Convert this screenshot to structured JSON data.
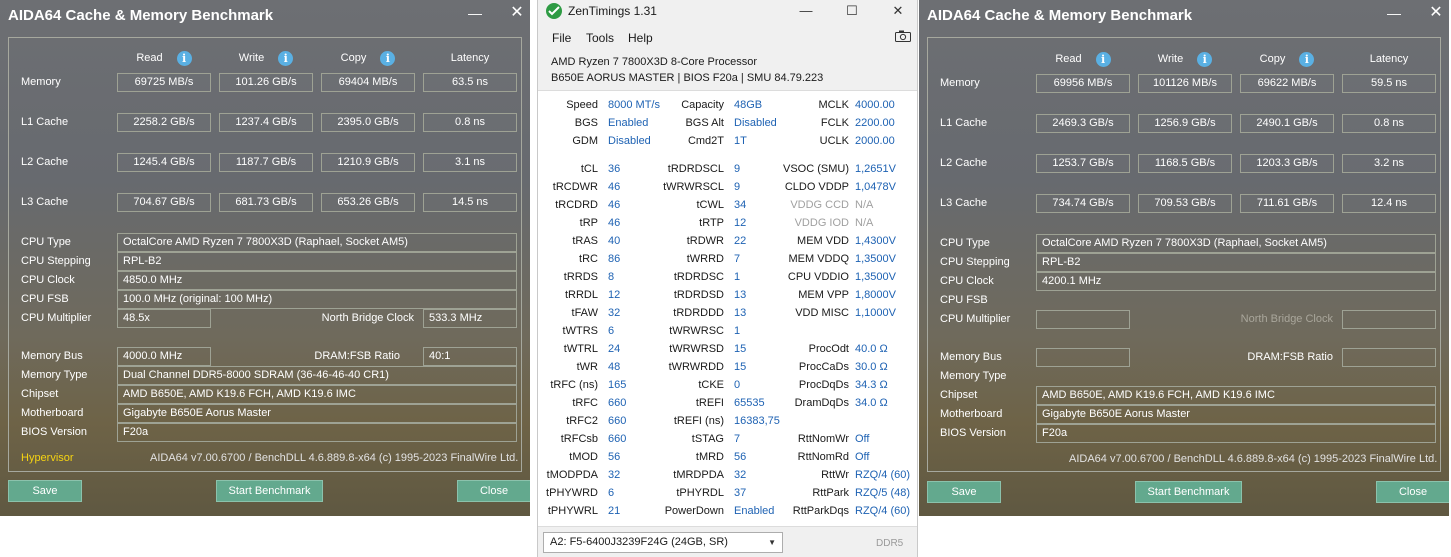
{
  "left": {
    "title": "AIDA64 Cache & Memory Benchmark",
    "min_glyph": "—",
    "close_glyph": "✕",
    "headers": [
      "Read",
      "Write",
      "Copy",
      "Latency"
    ],
    "rows": [
      {
        "label": "Memory",
        "read": "69725 MB/s",
        "write": "101.26 GB/s",
        "copy": "69404 MB/s",
        "latency": "63.5 ns"
      },
      {
        "label": "L1 Cache",
        "read": "2258.2 GB/s",
        "write": "1237.4 GB/s",
        "copy": "2395.0 GB/s",
        "latency": "0.8 ns"
      },
      {
        "label": "L2 Cache",
        "read": "1245.4 GB/s",
        "write": "1187.7 GB/s",
        "copy": "1210.9 GB/s",
        "latency": "3.1 ns"
      },
      {
        "label": "L3 Cache",
        "read": "704.67 GB/s",
        "write": "681.73 GB/s",
        "copy": "653.26 GB/s",
        "latency": "14.5 ns"
      }
    ],
    "cpu_type_label": "CPU Type",
    "cpu_type": "OctalCore AMD Ryzen 7 7800X3D  (Raphael, Socket AM5)",
    "cpu_stepping_label": "CPU Stepping",
    "cpu_stepping": "RPL-B2",
    "cpu_clock_label": "CPU Clock",
    "cpu_clock": "4850.0 MHz",
    "cpu_fsb_label": "CPU FSB",
    "cpu_fsb": "100.0 MHz  (original: 100 MHz)",
    "cpu_mult_label": "CPU Multiplier",
    "cpu_mult": "48.5x",
    "nb_clock_label": "North Bridge Clock",
    "nb_clock": "533.3 MHz",
    "mem_bus_label": "Memory Bus",
    "mem_bus": "4000.0 MHz",
    "dram_ratio_label": "DRAM:FSB Ratio",
    "dram_ratio": "40:1",
    "mem_type_label": "Memory Type",
    "mem_type": "Dual Channel DDR5-8000 SDRAM  (36-46-46-40 CR1)",
    "chipset_label": "Chipset",
    "chipset": "AMD B650E, AMD K19.6 FCH, AMD K19.6 IMC",
    "mobo_label": "Motherboard",
    "mobo": "Gigabyte B650E Aorus Master",
    "bios_label": "BIOS Version",
    "bios": "F20a",
    "hypervisor": "Hypervisor",
    "footer": "AIDA64 v7.00.6700 / BenchDLL 4.6.889.8-x64  (c) 1995-2023 FinalWire Ltd.",
    "save": "Save",
    "start": "Start Benchmark",
    "close": "Close"
  },
  "right": {
    "title": "AIDA64 Cache & Memory Benchmark",
    "min_glyph": "—",
    "close_glyph": "✕",
    "headers": [
      "Read",
      "Write",
      "Copy",
      "Latency"
    ],
    "rows": [
      {
        "label": "Memory",
        "read": "69956 MB/s",
        "write": "101126 MB/s",
        "copy": "69622 MB/s",
        "latency": "59.5 ns"
      },
      {
        "label": "L1 Cache",
        "read": "2469.3 GB/s",
        "write": "1256.9 GB/s",
        "copy": "2490.1 GB/s",
        "latency": "0.8 ns"
      },
      {
        "label": "L2 Cache",
        "read": "1253.7 GB/s",
        "write": "1168.5 GB/s",
        "copy": "1203.3 GB/s",
        "latency": "3.2 ns"
      },
      {
        "label": "L3 Cache",
        "read": "734.74 GB/s",
        "write": "709.53 GB/s",
        "copy": "711.61 GB/s",
        "latency": "12.4 ns"
      }
    ],
    "cpu_type_label": "CPU Type",
    "cpu_type": "OctalCore AMD Ryzen 7 7800X3D  (Raphael, Socket AM5)",
    "cpu_stepping_label": "CPU Stepping",
    "cpu_stepping": "RPL-B2",
    "cpu_clock_label": "CPU Clock",
    "cpu_clock": "4200.1 MHz",
    "cpu_fsb_label": "CPU FSB",
    "cpu_fsb": "",
    "cpu_mult_label": "CPU Multiplier",
    "cpu_mult": "",
    "nb_clock_label": "North Bridge Clock",
    "nb_clock": "",
    "mem_bus_label": "Memory Bus",
    "mem_bus": "",
    "dram_ratio_label": "DRAM:FSB Ratio",
    "dram_ratio": "",
    "mem_type_label": "Memory Type",
    "mem_type": "",
    "chipset_label": "Chipset",
    "chipset": "AMD B650E, AMD K19.6 FCH, AMD K19.6 IMC",
    "mobo_label": "Motherboard",
    "mobo": "Gigabyte B650E Aorus Master",
    "bios_label": "BIOS Version",
    "bios": "F20a",
    "hypervisor": "",
    "footer": "AIDA64 v7.00.6700 / BenchDLL 4.6.889.8-x64  (c) 1995-2023 FinalWire Ltd.",
    "save": "Save",
    "start": "Start Benchmark",
    "close": "Close"
  },
  "zen": {
    "title": "ZenTimings 1.31",
    "ctl_min": "—",
    "ctl_max": "☐",
    "ctl_close": "✕",
    "menu": [
      "File",
      "Tools",
      "Help"
    ],
    "cpu": "AMD Ryzen 7 7800X3D 8-Core Processor",
    "board": "B650E AORUS MASTER | BIOS F20a | SMU 84.79.223",
    "top": [
      [
        "Speed",
        "8000 MT/s",
        "Capacity",
        "48GB",
        "MCLK",
        "4000.00"
      ],
      [
        "BGS",
        "Enabled",
        "BGS Alt",
        "Disabled",
        "FCLK",
        "2200.00"
      ],
      [
        "GDM",
        "Disabled",
        "Cmd2T",
        "1T",
        "UCLK",
        "2000.00"
      ]
    ],
    "timings": [
      [
        "tCL",
        "36",
        "tRDRDSCL",
        "9",
        "VSOC (SMU)",
        "1,2651V"
      ],
      [
        "tRCDWR",
        "46",
        "tWRWRSCL",
        "9",
        "CLDO VDDP",
        "1,0478V"
      ],
      [
        "tRCDRD",
        "46",
        "tCWL",
        "34",
        "VDDG CCD",
        "N/A"
      ],
      [
        "tRP",
        "46",
        "tRTP",
        "12",
        "VDDG IOD",
        "N/A"
      ],
      [
        "tRAS",
        "40",
        "tRDWR",
        "22",
        "MEM VDD",
        "1,4300V"
      ],
      [
        "tRC",
        "86",
        "tWRRD",
        "7",
        "MEM VDDQ",
        "1,3500V"
      ],
      [
        "tRRDS",
        "8",
        "tRDRDSC",
        "1",
        "CPU VDDIO",
        "1,3500V"
      ],
      [
        "tRRDL",
        "12",
        "tRDRDSD",
        "13",
        "MEM VPP",
        "1,8000V"
      ],
      [
        "tFAW",
        "32",
        "tRDRDDD",
        "13",
        "VDD MISC",
        "1,1000V"
      ],
      [
        "tWTRS",
        "6",
        "tWRWRSC",
        "1",
        "",
        ""
      ],
      [
        "tWTRL",
        "24",
        "tWRWRSD",
        "15",
        "ProcOdt",
        "40.0 Ω"
      ],
      [
        "tWR",
        "48",
        "tWRWRDD",
        "15",
        "ProcCaDs",
        "30.0 Ω"
      ],
      [
        "tRFC (ns)",
        "165",
        "tCKE",
        "0",
        "ProcDqDs",
        "34.3 Ω"
      ],
      [
        "tRFC",
        "660",
        "tREFI",
        "65535",
        "DramDqDs",
        "34.0 Ω"
      ],
      [
        "tRFC2",
        "660",
        "tREFI (ns)",
        "16383,75",
        "",
        ""
      ],
      [
        "tRFCsb",
        "660",
        "tSTAG",
        "7",
        "RttNomWr",
        "Off"
      ],
      [
        "tMOD",
        "56",
        "tMRD",
        "56",
        "RttNomRd",
        "Off"
      ],
      [
        "tMODPDA",
        "32",
        "tMRDPDA",
        "32",
        "RttWr",
        "RZQ/4 (60)"
      ],
      [
        "tPHYWRD",
        "6",
        "tPHYRDL",
        "37",
        "RttPark",
        "RZQ/5 (48)"
      ],
      [
        "tPHYWRL",
        "21",
        "PowerDown",
        "Enabled",
        "RttParkDqs",
        "RZQ/4 (60)"
      ]
    ],
    "module": "A2: F5-6400J3239F24G (24GB, SR)",
    "module_arrow": "▼",
    "ddr": "DDR5"
  }
}
